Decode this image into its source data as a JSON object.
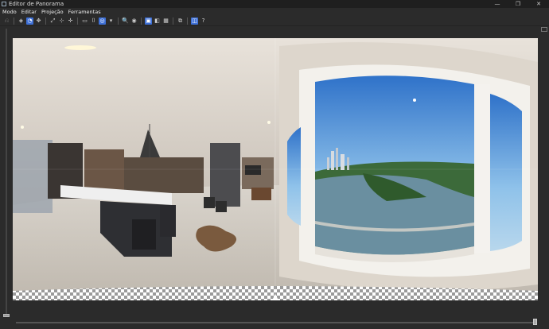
{
  "window": {
    "title": "Editor de Panorama"
  },
  "menu": {
    "items": [
      "Modo",
      "Editar",
      "Projeção",
      "Ferramentas"
    ]
  },
  "colors": {
    "accent": "#3d6fd6",
    "background": "#2b2b2b"
  }
}
